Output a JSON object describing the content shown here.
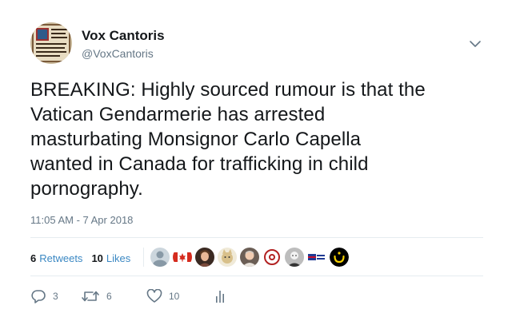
{
  "author": {
    "display_name": "Vox Cantoris",
    "handle": "@VoxCantoris",
    "avatar_icon": "manuscript-avatar"
  },
  "tweet": {
    "text_lines": [
      "BREAKING: Highly sourced rumour is that the",
      "Vatican Gendarmerie has arrested",
      "masturbating Monsignor Carlo Capella",
      "wanted in Canada for trafficking in child",
      "pornography."
    ],
    "timestamp": "11:05 AM - 7 Apr 2018"
  },
  "stats": {
    "retweets_count": "6",
    "retweets_label": "Retweets",
    "likes_count": "10",
    "likes_label": "Likes"
  },
  "likers": [
    "default-person-icon",
    "canada-flag-icon",
    "woman-avatar-icon",
    "cat-avatar-icon",
    "man-avatar-icon",
    "emblem-avatar-icon",
    "bw-avatar-icon",
    "flags-avatar-icon",
    "nun-letter-avatar-icon"
  ],
  "actions": {
    "reply_count": "3",
    "retweet_count": "6",
    "like_count": "10"
  },
  "colors": {
    "text": "#14171a",
    "secondary": "#657786",
    "link": "#3b88c3",
    "divider": "#e6ecf0"
  }
}
